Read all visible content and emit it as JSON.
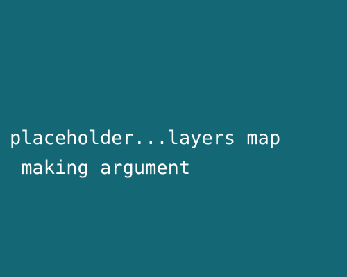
{
  "canvas": {
    "background_color": "#146875",
    "text_color": "#ffffff",
    "text_line_1": "placeholder...layers map",
    "text_line_2": " making argument"
  }
}
